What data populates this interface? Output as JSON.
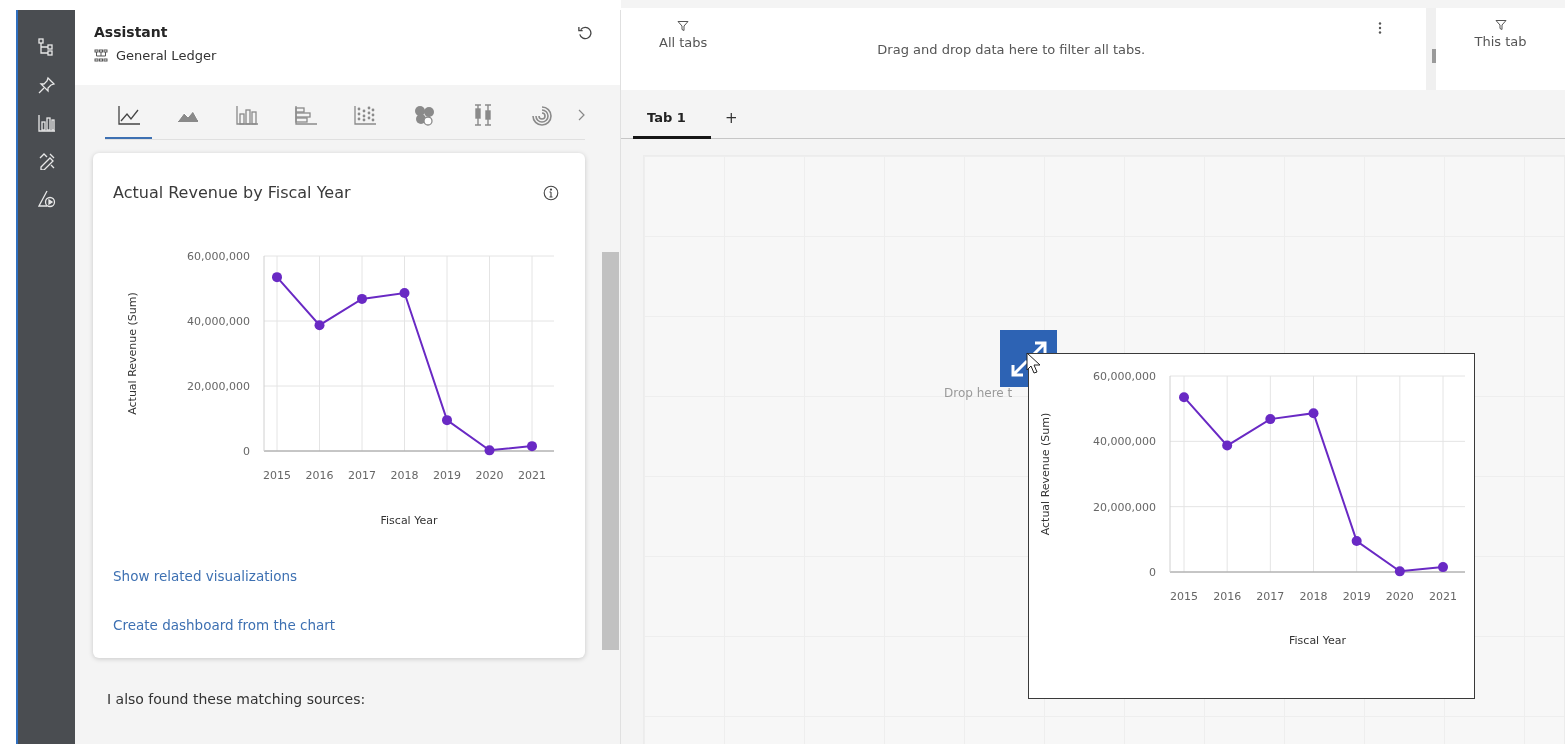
{
  "assistant": {
    "title": "Assistant",
    "source": "General Ledger",
    "chart_types": [
      {
        "kind": "line",
        "selected": true
      },
      {
        "kind": "area",
        "selected": false
      },
      {
        "kind": "bar",
        "selected": false
      },
      {
        "kind": "hbar",
        "selected": false
      },
      {
        "kind": "scatter",
        "selected": false
      },
      {
        "kind": "bubble",
        "selected": false
      },
      {
        "kind": "boxplot",
        "selected": false
      },
      {
        "kind": "radial",
        "selected": false
      }
    ],
    "card": {
      "title": "Actual Revenue by Fiscal Year",
      "chart_data": {
        "type": "line",
        "xlabel": "Fiscal Year",
        "ylabel": "Actual Revenue (Sum)",
        "categories": [
          "2015",
          "2016",
          "2017",
          "2018",
          "2019",
          "2020",
          "2021"
        ],
        "series": [
          {
            "color": "#6929c4",
            "marker": true,
            "values": [
              53500000,
              38700000,
              46800000,
              48600000,
              9500000,
              200000,
              1500000
            ]
          }
        ],
        "ylim": [
          0,
          60000000
        ],
        "grid": true,
        "yticks": [
          {
            "value": 0,
            "label": "0"
          },
          {
            "value": 20000000,
            "label": "20,000,000"
          },
          {
            "value": 40000000,
            "label": "40,000,000"
          },
          {
            "value": 60000000,
            "label": "60,000,000"
          }
        ]
      },
      "links": [
        "Show related visualizations",
        "Create dashboard from the chart"
      ]
    },
    "footer_text": "I also found these matching sources:"
  },
  "filters": {
    "all_tabs": {
      "label": "All tabs",
      "hint": "Drag and drop data here to filter all tabs."
    },
    "this_tab": {
      "label": "This tab"
    }
  },
  "tabs": [
    {
      "label": "Tab 1",
      "selected": true
    }
  ],
  "add_tab": "+",
  "canvas": {
    "drop_hint": "Drop here t",
    "drag_preview": {
      "chart_data": {
        "type": "line",
        "xlabel": "Fiscal Year",
        "ylabel": "Actual Revenue (Sum)",
        "categories": [
          "2015",
          "2016",
          "2017",
          "2018",
          "2019",
          "2020",
          "2021"
        ],
        "series": [
          {
            "color": "#6929c4",
            "marker": true,
            "values": [
              53500000,
              38700000,
              46800000,
              48600000,
              9500000,
              200000,
              1500000
            ]
          }
        ],
        "ylim": [
          0,
          60000000
        ],
        "grid": true,
        "yticks": [
          {
            "value": 0,
            "label": "0"
          },
          {
            "value": 20000000,
            "label": "20,000,000"
          },
          {
            "value": 40000000,
            "label": "40,000,000"
          },
          {
            "value": 60000000,
            "label": "60,000,000"
          }
        ]
      }
    }
  }
}
